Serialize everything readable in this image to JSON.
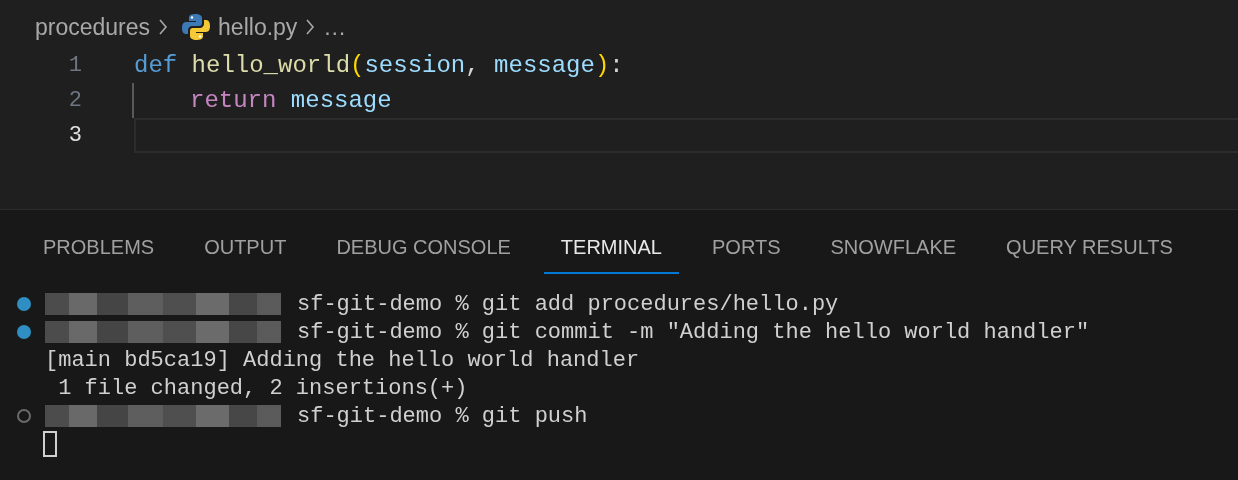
{
  "breadcrumb": {
    "folder": "procedures",
    "file": "hello.py",
    "more": "…"
  },
  "editor": {
    "lines": [
      {
        "number": "1",
        "current": false,
        "indent": false,
        "tokens": [
          {
            "kind": "keyword",
            "text": "def "
          },
          {
            "kind": "function",
            "text": "hello_world"
          },
          {
            "kind": "bracket",
            "text": "("
          },
          {
            "kind": "param",
            "text": "session"
          },
          {
            "kind": "punct",
            "text": ", "
          },
          {
            "kind": "variable",
            "text": "message"
          },
          {
            "kind": "bracket",
            "text": ")"
          },
          {
            "kind": "punct",
            "text": ":"
          }
        ]
      },
      {
        "number": "2",
        "current": false,
        "indent": true,
        "tokens": [
          {
            "kind": "control",
            "text": "return "
          },
          {
            "kind": "variable",
            "text": "message"
          }
        ]
      },
      {
        "number": "3",
        "current": true,
        "indent": false
      }
    ]
  },
  "panel_tabs": [
    {
      "label": "PROBLEMS",
      "selected": false
    },
    {
      "label": "OUTPUT",
      "selected": false
    },
    {
      "label": "DEBUG CONSOLE",
      "selected": false
    },
    {
      "label": "TERMINAL",
      "selected": true
    },
    {
      "label": "PORTS",
      "selected": false
    },
    {
      "label": "SNOWFLAKE",
      "selected": false
    },
    {
      "label": "QUERY RESULTS",
      "selected": false
    }
  ],
  "terminal": {
    "lines": [
      {
        "kind": "prompt",
        "completed": true,
        "text": "sf-git-demo % git add procedures/hello.py"
      },
      {
        "kind": "prompt",
        "completed": true,
        "text": "sf-git-demo % git commit -m \"Adding the hello world handler\""
      },
      {
        "kind": "output",
        "text": "[main bd5ca19] Adding the hello world handler"
      },
      {
        "kind": "output",
        "text": " 1 file changed, 2 insertions(+)"
      },
      {
        "kind": "prompt",
        "completed": false,
        "text": "sf-git-demo % git push"
      },
      {
        "kind": "cursor"
      }
    ]
  }
}
